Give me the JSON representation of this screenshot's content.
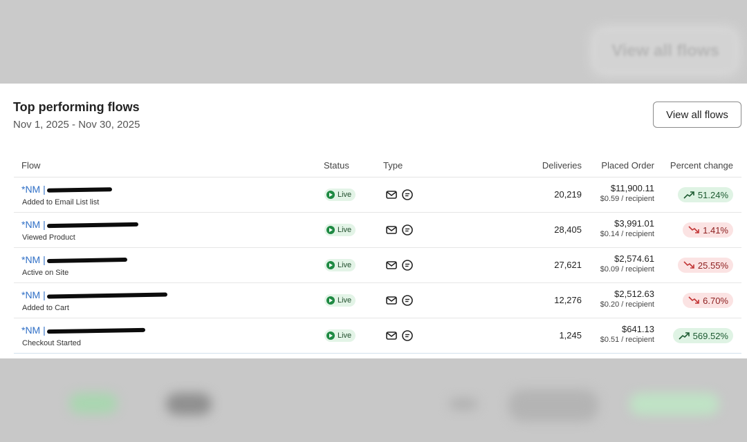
{
  "background": {
    "ghost_button_label": "View all flows"
  },
  "card": {
    "title": "Top performing flows",
    "date_range": "Nov 1, 2025 - Nov 30, 2025",
    "view_all_label": "View all flows"
  },
  "table": {
    "headers": {
      "flow": "Flow",
      "status": "Status",
      "type": "Type",
      "deliveries": "Deliveries",
      "placed_order": "Placed Order",
      "percent_change": "Percent change"
    },
    "rows": [
      {
        "prefix": "*NM |",
        "redacted_len": 94,
        "trigger": "Added to Email List list",
        "status": "Live",
        "deliveries": "20,219",
        "placed": "$11,900.11",
        "per_recipient": "$0.59 / recipient",
        "change": "51.24%",
        "direction": "up"
      },
      {
        "prefix": "*NM |",
        "redacted_len": 132,
        "trigger": "Viewed Product",
        "status": "Live",
        "deliveries": "28,405",
        "placed": "$3,991.01",
        "per_recipient": "$0.14 / recipient",
        "change": "1.41%",
        "direction": "down"
      },
      {
        "prefix": "*NM |",
        "redacted_len": 116,
        "trigger": "Active on Site",
        "status": "Live",
        "deliveries": "27,621",
        "placed": "$2,574.61",
        "per_recipient": "$0.09 / recipient",
        "change": "25.55%",
        "direction": "down"
      },
      {
        "prefix": "*NM |",
        "redacted_len": 174,
        "trigger": "Added to Cart",
        "status": "Live",
        "deliveries": "12,276",
        "placed": "$2,512.63",
        "per_recipient": "$0.20 / recipient",
        "change": "6.70%",
        "direction": "down"
      },
      {
        "prefix": "*NM |",
        "redacted_len": 142,
        "trigger": "Checkout Started",
        "status": "Live",
        "deliveries": "1,245",
        "placed": "$641.13",
        "per_recipient": "$0.51 / recipient",
        "change": "569.52%",
        "direction": "up"
      }
    ]
  },
  "icons": {
    "status": "play-circle-icon",
    "type_email": "envelope-icon",
    "type_sms": "chat-bubble-icon",
    "change_up": "trend-up-icon",
    "change_down": "trend-down-icon"
  },
  "colors": {
    "link": "#2f6fc6",
    "live_green": "#1f8a43",
    "positive_bg": "#dff3e4",
    "negative_bg": "#fbe3e3"
  }
}
